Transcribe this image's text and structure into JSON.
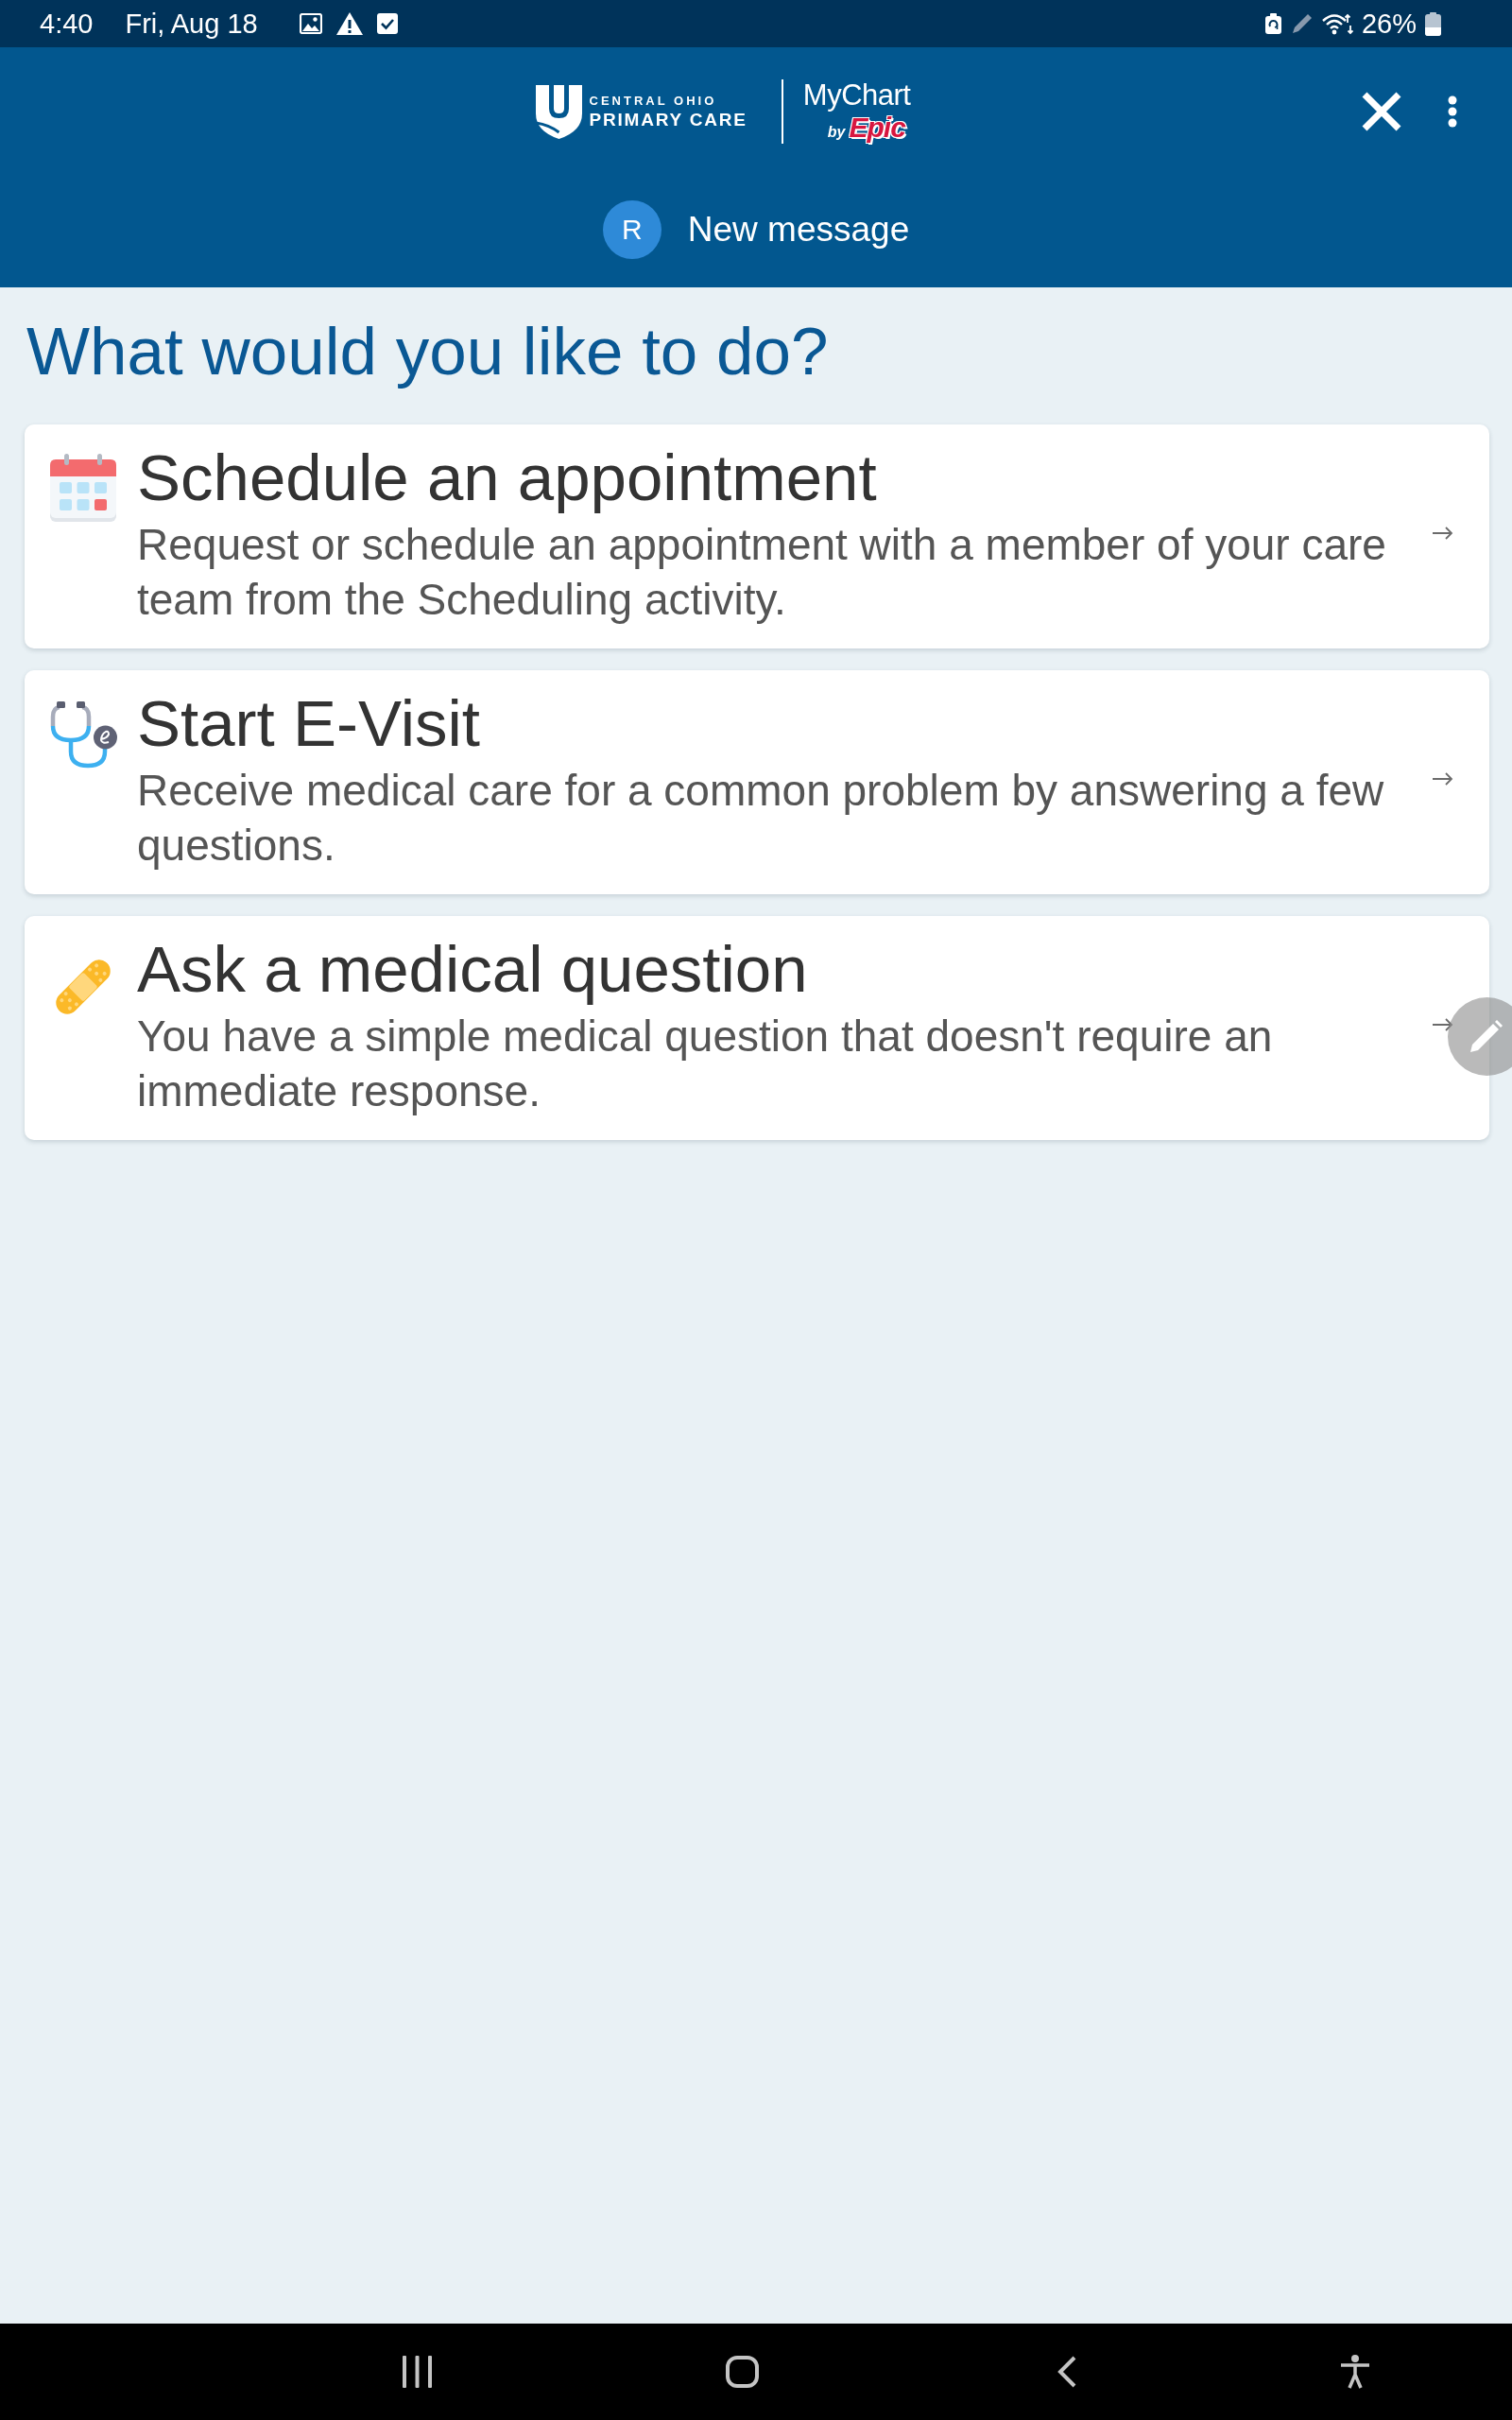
{
  "status_bar": {
    "time": "4:40",
    "date": "Fri, Aug 18",
    "battery": "26%"
  },
  "header": {
    "logo": {
      "org_line_1": "CENTRAL OHIO",
      "org_line_2": "PRIMARY CARE",
      "app_name": "MyChart",
      "app_by": "by",
      "app_vendor": "Epic"
    },
    "avatar_initial": "R",
    "title": "New message"
  },
  "heading": "What would you like to do?",
  "options": [
    {
      "kind": "calendar",
      "title": "Schedule an appointment",
      "description": "Request or schedule an appointment with a member of your care team from the Scheduling activity."
    },
    {
      "kind": "stethoscope",
      "title": "Start E-Visit",
      "description": "Receive medical care for a common problem by answering a few questions."
    },
    {
      "kind": "bandage",
      "title": "Ask a medical question",
      "description": "You have a simple medical question that doesn't require an immediate response."
    }
  ]
}
